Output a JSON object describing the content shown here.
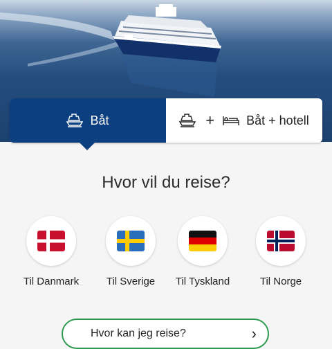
{
  "tabs": [
    {
      "label": "Båt",
      "icon": "ship-icon",
      "selected": true
    },
    {
      "label": "Båt + hotell",
      "icons": [
        "ship-icon",
        "plus-icon",
        "bed-icon"
      ],
      "selected": false
    }
  ],
  "question": "Hvor vil du reise?",
  "destinations": [
    {
      "label": "Til Danmark",
      "flag": "denmark-flag-icon"
    },
    {
      "label": "Til Sverige",
      "flag": "sweden-flag-icon"
    },
    {
      "label": "Til Tyskland",
      "flag": "germany-flag-icon"
    },
    {
      "label": "Til Norge",
      "flag": "norway-flag-icon"
    }
  ],
  "bottom_button": {
    "label": "Hvor kan jeg reise?",
    "icon": "chevron-right-icon"
  },
  "colors": {
    "primary": "#0c3f7f",
    "accent_green": "#2e9a4f"
  }
}
